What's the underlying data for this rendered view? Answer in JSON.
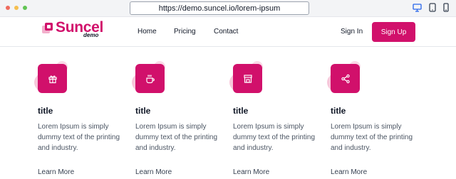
{
  "browser": {
    "url": "https://demo.suncel.io/lorem-ipsum"
  },
  "header": {
    "logo_text": "Suncel",
    "logo_sub": "demo",
    "nav": [
      "Home",
      "Pricing",
      "Contact"
    ],
    "signin": "Sign In",
    "signup": "Sign Up"
  },
  "colors": {
    "brand": "#d1106b"
  },
  "features": [
    {
      "icon": "gift-icon",
      "title": "title",
      "description": "Lorem Ipsum is simply dummy text of the printing and industry.",
      "link": "Learn More"
    },
    {
      "icon": "coffee-icon",
      "title": "title",
      "description": "Lorem Ipsum is simply dummy text of the printing and industry.",
      "link": "Learn More"
    },
    {
      "icon": "store-icon",
      "title": "title",
      "description": "Lorem Ipsum is simply dummy text of the printing and industry.",
      "link": "Learn More"
    },
    {
      "icon": "share-icon",
      "title": "title",
      "description": "Lorem Ipsum is simply dummy text of the printing and industry.",
      "link": "Learn More"
    }
  ]
}
